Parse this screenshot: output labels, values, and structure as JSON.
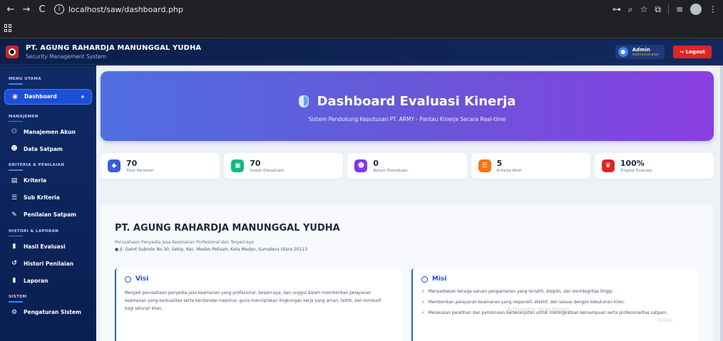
{
  "browser": {
    "url": "localhost/saw/dashboard.php",
    "back_icon": "←",
    "forward_icon": "→",
    "reload_icon": "C"
  },
  "header": {
    "company": "PT. AGUNG RAHARDJA MANUNGGAL YUDHA",
    "system": "Security Management System",
    "user_name": "Admin",
    "user_role": "Administrator",
    "logout_label": "Logout"
  },
  "sidebar": {
    "sections": [
      {
        "title": "MENU UTAMA"
      },
      {
        "title": "MANAJEMEN"
      },
      {
        "title": "KRITERIA & PENILAIAN"
      },
      {
        "title": "HISTORI & LAPORAN"
      },
      {
        "title": "SISTEM"
      }
    ],
    "items": [
      {
        "label": "Dashboard",
        "icon": "gauge-icon"
      },
      {
        "label": "Manajemen Akun",
        "icon": "users-cog-icon"
      },
      {
        "label": "Data Satpam",
        "icon": "user-group-icon"
      },
      {
        "label": "Kriteria",
        "icon": "clipboard-icon"
      },
      {
        "label": "Sub Kriteria",
        "icon": "list-icon"
      },
      {
        "label": "Penilaian Satpam",
        "icon": "edit-icon"
      },
      {
        "label": "Hasil Evaluasi",
        "icon": "file-icon"
      },
      {
        "label": "Histori Penilaian",
        "icon": "history-icon"
      },
      {
        "label": "Laporan",
        "icon": "report-icon"
      },
      {
        "label": "Pengaturan Sistem",
        "icon": "gear-icon"
      }
    ]
  },
  "hero": {
    "title": "Dashboard Evaluasi Kinerja",
    "subtitle": "Sistem Pendukung Keputusan PT. ARMY - Pantau Kinerja Secara Real-time"
  },
  "stats": [
    {
      "value": "70",
      "label": "Total Personel",
      "color": "#3b5bdb",
      "icon": "shield-icon"
    },
    {
      "value": "70",
      "label": "Sudah Dievaluasi",
      "color": "#10b981",
      "icon": "clipboard-check-icon"
    },
    {
      "value": "0",
      "label": "Belum Dievaluasi",
      "color": "#7c3aed",
      "icon": "user-clock-icon"
    },
    {
      "value": "5",
      "label": "Kriteria Aktif",
      "color": "#f97316",
      "icon": "list-check-icon"
    },
    {
      "value": "100%",
      "label": "Tingkat Evaluasi",
      "color": "#dc2626",
      "icon": "trophy-icon"
    }
  ],
  "company": {
    "name": "PT. AGUNG RAHARDJA MANUNGGAL YUDHA",
    "tagline": "Perusahaan Penyedia Jasa Keamanan Profesional dan Terpercaya",
    "address": "Jl. Gatot Subroto No.30, Sekip, Kec. Medan Petisah, Kota Medan, Sumatera Utara 20113",
    "visi_title": "Visi",
    "visi_text": "Menjadi perusahaan penyedia jasa keamanan yang profesional, terpercaya, dan unggul dalam memberikan pelayanan keamanan yang berkualitas serta berstandar nasional, guna menciptakan lingkungan kerja yang aman, tertib, dan kondusif bagi seluruh klien.",
    "misi_title": "Misi",
    "misi": [
      "Menyediakan tenaga satuan pengamanan yang terlatih, disiplin, dan berintegritas tinggi.",
      "Memberikan pelayanan keamanan yang responsif, efektif, dan sesuai dengan kebutuhan klien.",
      "Melakukan pelatihan dan pembinaan berkelanjutan untuk meningkatkan kemampuan serta profesionalitas satpam."
    ]
  },
  "watermark": {
    "line1": "Activate Windows",
    "line2": "dows."
  }
}
